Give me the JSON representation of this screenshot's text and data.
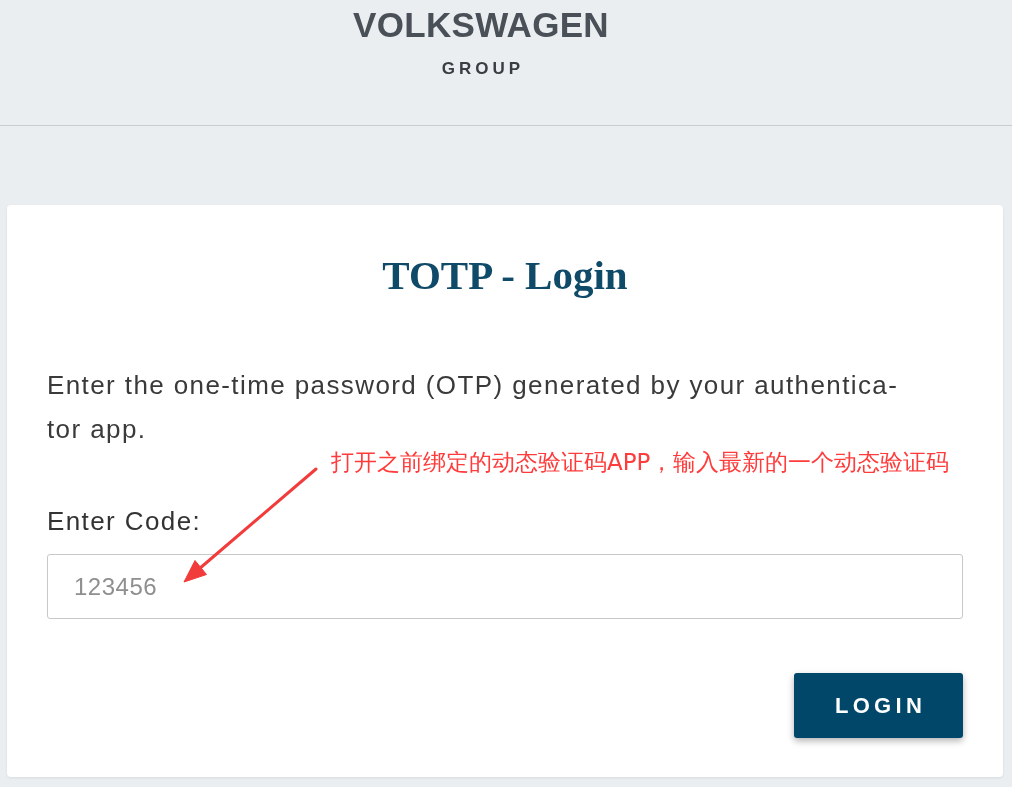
{
  "header": {
    "logo": {
      "wordmark": "VOLKSWAGEN",
      "subline": "GROUP"
    }
  },
  "login_card": {
    "title": "TOTP - Login",
    "instructions": "Enter the one-time password (OTP) generated by your authentica-tor app.",
    "code_field": {
      "label": "Enter Code:",
      "placeholder": "123456"
    },
    "login_button": {
      "label": "LOGIN"
    }
  },
  "annotation": {
    "text": "打开之前绑定的动态验证码APP，输入最新的一个动态验证码"
  }
}
